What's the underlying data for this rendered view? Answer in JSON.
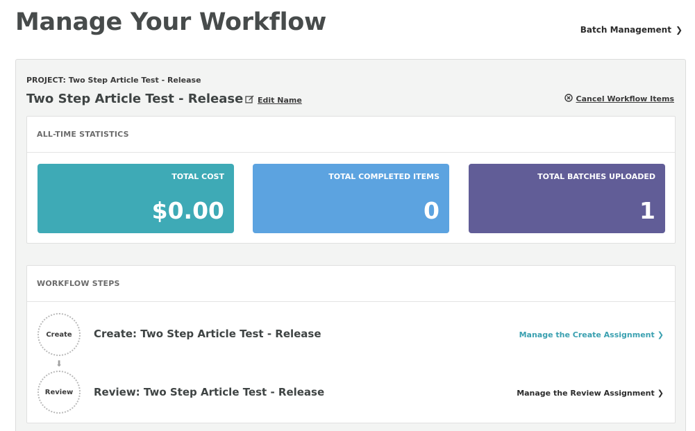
{
  "page": {
    "title": "Manage Your Workflow",
    "batch_management": "Batch Management"
  },
  "project": {
    "label": "PROJECT: Two Step Article Test - Release",
    "name": "Two Step Article Test - Release",
    "edit_name": "Edit Name",
    "cancel_items": "Cancel Workflow Items"
  },
  "stats": {
    "header": "ALL-TIME STATISTICS",
    "tiles": [
      {
        "label": "TOTAL COST",
        "value": "$0.00",
        "color": "#3eaab6"
      },
      {
        "label": "TOTAL COMPLETED ITEMS",
        "value": "0",
        "color": "#5ca3e0"
      },
      {
        "label": "TOTAL BATCHES UPLOADED",
        "value": "1",
        "color": "#615d97"
      }
    ]
  },
  "steps": {
    "header": "WORKFLOW STEPS",
    "items": [
      {
        "badge": "Create",
        "title": "Create: Two Step Article Test - Release",
        "link": "Manage the Create Assignment",
        "link_color": "#3aa0b0"
      },
      {
        "badge": "Review",
        "title": "Review: Two Step Article Test - Release",
        "link": "Manage the Review Assignment",
        "link_color": "#2b2b2b"
      }
    ]
  },
  "icons": {
    "chevron": "chevron-right-icon",
    "edit": "pencil-square-icon",
    "cancel": "circle-x-icon",
    "arrow": "arrow-down-icon"
  }
}
